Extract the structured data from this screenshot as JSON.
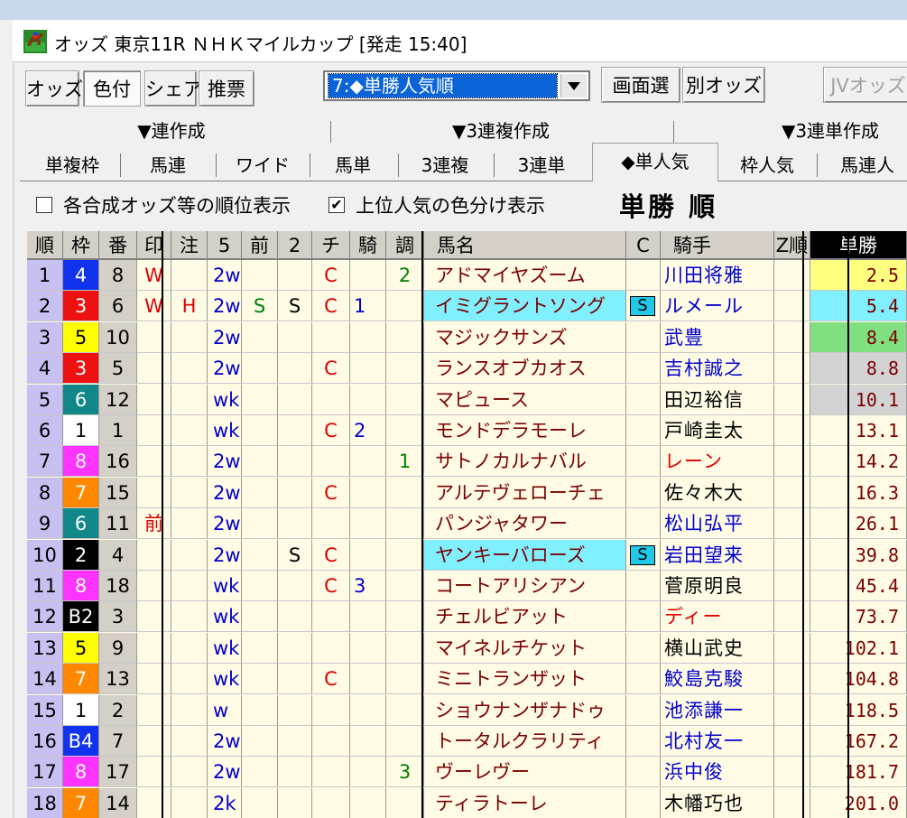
{
  "window": {
    "title": "オッズ 東京11R ＮＨＫマイルカップ [発走 15:40]"
  },
  "toolbar": {
    "buttons": [
      {
        "label": "オッズ",
        "pressed": false
      },
      {
        "label": "色付",
        "pressed": true
      },
      {
        "label": "シェア",
        "pressed": false
      },
      {
        "label": "推票",
        "pressed": false
      }
    ],
    "select_value": "7:◆単勝人気順",
    "screen_select": "画面選",
    "other_odds": "別オッズ",
    "jv_odds": "JVオッズ"
  },
  "groups": [
    "▼連作成",
    "▼3連複作成",
    "▼3連単作成"
  ],
  "tabs": [
    "単複枠",
    "馬連",
    "ワイド",
    "馬単",
    "3連複",
    "3連単",
    "◆単人気",
    "枠人気",
    "馬連人"
  ],
  "active_tab": 6,
  "options": {
    "show_rank": {
      "label": "各合成オッズ等の順位表示",
      "checked": false
    },
    "color_top": {
      "label": "上位人気の色分け表示",
      "checked": true
    },
    "order_label": "単勝 順"
  },
  "columns": [
    "順",
    "枠",
    "番",
    "印",
    "注",
    "5",
    "前",
    "2",
    "チ",
    "騎",
    "調",
    "馬名",
    "C",
    "騎手",
    "Z順",
    "単勝"
  ],
  "colors": {
    "waku": {
      "1": "#ffffff",
      "2": "#000000",
      "3": "#ee1111",
      "4": "#1133ee",
      "5": "#ffff00",
      "6": "#11878a",
      "7": "#ff8800",
      "8": "#ff33ff"
    },
    "odds_top1": "#ffff80",
    "odds_top2": "#80f0ff",
    "odds_top3": "#80e080",
    "odds_top45": "#d3d3d3",
    "name_highlight": "#80f0ff",
    "jockey_blue": "#0000cc",
    "jockey_red": "#dd0000",
    "jockey_black": "#000000"
  },
  "rows": [
    {
      "rank": "1",
      "waku": "4",
      "waku_color": 4,
      "num": "8",
      "mark": "W",
      "note": "",
      "five": "2w",
      "mae": "",
      "two": "",
      "chi": "C",
      "ki": "",
      "cho": "2",
      "name": "アドマイヤズーム",
      "c": "",
      "jockey": "川田将雅",
      "jc": "blue",
      "odds": "2.5",
      "oddsbg": "top1"
    },
    {
      "rank": "2",
      "waku": "3",
      "waku_color": 3,
      "num": "6",
      "mark": "W",
      "note": "H",
      "five": "2w",
      "mae": "S",
      "two": "S",
      "chi": "C",
      "ki": "1",
      "cho": "",
      "name": "イミグラントソング",
      "c": "S",
      "jockey": "ルメール",
      "jc": "blue",
      "odds": "5.4",
      "oddsbg": "top2",
      "hl": true
    },
    {
      "rank": "3",
      "waku": "5",
      "waku_color": 5,
      "num": "10",
      "mark": "",
      "note": "",
      "five": "2w",
      "mae": "",
      "two": "",
      "chi": "",
      "ki": "",
      "cho": "",
      "name": "マジックサンズ",
      "c": "",
      "jockey": "武豊",
      "jc": "blue",
      "odds": "8.4",
      "oddsbg": "top3"
    },
    {
      "rank": "4",
      "waku": "3",
      "waku_color": 3,
      "num": "5",
      "mark": "",
      "note": "",
      "five": "2w",
      "mae": "",
      "two": "",
      "chi": "C",
      "ki": "",
      "cho": "",
      "name": "ランスオブカオス",
      "c": "",
      "jockey": "吉村誠之",
      "jc": "blue",
      "odds": "8.8",
      "oddsbg": "top45"
    },
    {
      "rank": "5",
      "waku": "6",
      "waku_color": 6,
      "num": "12",
      "mark": "",
      "note": "",
      "five": "wk",
      "mae": "",
      "two": "",
      "chi": "",
      "ki": "",
      "cho": "",
      "name": "マピュース",
      "c": "",
      "jockey": "田辺裕信",
      "jc": "black",
      "odds": "10.1",
      "oddsbg": "top45"
    },
    {
      "rank": "6",
      "waku": "1",
      "waku_color": 1,
      "num": "1",
      "mark": "",
      "note": "",
      "five": "wk",
      "mae": "",
      "two": "",
      "chi": "C",
      "ki": "2",
      "cho": "",
      "name": "モンドデラモーレ",
      "c": "",
      "jockey": "戸崎圭太",
      "jc": "black",
      "odds": "13.1",
      "oddsbg": ""
    },
    {
      "rank": "7",
      "waku": "8",
      "waku_color": 8,
      "num": "16",
      "mark": "",
      "note": "",
      "five": "2w",
      "mae": "",
      "two": "",
      "chi": "",
      "ki": "",
      "cho": "1",
      "name": "サトノカルナバル",
      "c": "",
      "jockey": "レーン",
      "jc": "red",
      "odds": "14.2",
      "oddsbg": ""
    },
    {
      "rank": "8",
      "waku": "7",
      "waku_color": 7,
      "num": "15",
      "mark": "",
      "note": "",
      "five": "2w",
      "mae": "",
      "two": "",
      "chi": "C",
      "ki": "",
      "cho": "",
      "name": "アルテヴェローチェ",
      "c": "",
      "jockey": "佐々木大",
      "jc": "black",
      "odds": "16.3",
      "oddsbg": ""
    },
    {
      "rank": "9",
      "waku": "6",
      "waku_color": 6,
      "num": "11",
      "mark": "前",
      "note": "",
      "five": "2w",
      "mae": "",
      "two": "",
      "chi": "",
      "ki": "",
      "cho": "",
      "name": "パンジャタワー",
      "c": "",
      "jockey": "松山弘平",
      "jc": "blue",
      "odds": "26.1",
      "oddsbg": ""
    },
    {
      "rank": "10",
      "waku": "2",
      "waku_color": 2,
      "num": "4",
      "mark": "",
      "note": "",
      "five": "2w",
      "mae": "",
      "two": "S",
      "chi": "C",
      "ki": "",
      "cho": "",
      "name": "ヤンキーバローズ",
      "c": "S",
      "jockey": "岩田望来",
      "jc": "blue",
      "odds": "39.8",
      "oddsbg": "",
      "hl": true
    },
    {
      "rank": "11",
      "waku": "8",
      "waku_color": 8,
      "num": "18",
      "mark": "",
      "note": "",
      "five": "wk",
      "mae": "",
      "two": "",
      "chi": "C",
      "ki": "3",
      "cho": "",
      "name": "コートアリシアン",
      "c": "",
      "jockey": "菅原明良",
      "jc": "black",
      "odds": "45.4",
      "oddsbg": ""
    },
    {
      "rank": "12",
      "waku": "B2",
      "waku_color": 2,
      "num": "3",
      "mark": "",
      "note": "",
      "five": "wk",
      "mae": "",
      "two": "",
      "chi": "",
      "ki": "",
      "cho": "",
      "name": "チェルビアット",
      "c": "",
      "jockey": "ディー",
      "jc": "red",
      "odds": "73.7",
      "oddsbg": ""
    },
    {
      "rank": "13",
      "waku": "5",
      "waku_color": 5,
      "num": "9",
      "mark": "",
      "note": "",
      "five": "wk",
      "mae": "",
      "two": "",
      "chi": "",
      "ki": "",
      "cho": "",
      "name": "マイネルチケット",
      "c": "",
      "jockey": "横山武史",
      "jc": "black",
      "odds": "102.1",
      "oddsbg": ""
    },
    {
      "rank": "14",
      "waku": "7",
      "waku_color": 7,
      "num": "13",
      "mark": "",
      "note": "",
      "five": "wk",
      "mae": "",
      "two": "",
      "chi": "C",
      "ki": "",
      "cho": "",
      "name": "ミニトランザット",
      "c": "",
      "jockey": "鮫島克駿",
      "jc": "blue",
      "odds": "104.8",
      "oddsbg": ""
    },
    {
      "rank": "15",
      "waku": "1",
      "waku_color": 1,
      "num": "2",
      "mark": "",
      "note": "",
      "five": "w",
      "mae": "",
      "two": "",
      "chi": "",
      "ki": "",
      "cho": "",
      "name": "ショウナンザナドゥ",
      "c": "",
      "jockey": "池添謙一",
      "jc": "blue",
      "odds": "118.5",
      "oddsbg": ""
    },
    {
      "rank": "16",
      "waku": "B4",
      "waku_color": 4,
      "num": "7",
      "mark": "",
      "note": "",
      "five": "2w",
      "mae": "",
      "two": "",
      "chi": "",
      "ki": "",
      "cho": "",
      "name": "トータルクラリティ",
      "c": "",
      "jockey": "北村友一",
      "jc": "blue",
      "odds": "167.2",
      "oddsbg": ""
    },
    {
      "rank": "17",
      "waku": "8",
      "waku_color": 8,
      "num": "17",
      "mark": "",
      "note": "",
      "five": "2w",
      "mae": "",
      "two": "",
      "chi": "",
      "ki": "",
      "cho": "3",
      "name": "ヴーレヴー",
      "c": "",
      "jockey": "浜中俊",
      "jc": "blue",
      "odds": "181.7",
      "oddsbg": ""
    },
    {
      "rank": "18",
      "waku": "7",
      "waku_color": 7,
      "num": "14",
      "mark": "",
      "note": "",
      "five": "2k",
      "mae": "",
      "two": "",
      "chi": "",
      "ki": "",
      "cho": "",
      "name": "ティラトーレ",
      "c": "",
      "jockey": "木幡巧也",
      "jc": "black",
      "odds": "201.0",
      "oddsbg": ""
    }
  ]
}
